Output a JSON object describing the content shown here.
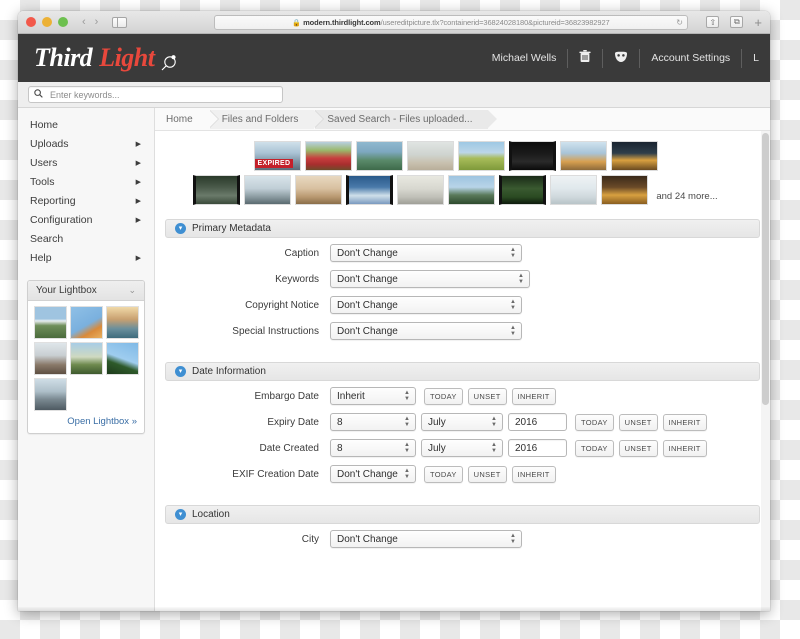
{
  "browser": {
    "url_prefix": "modern.thirdlight.com",
    "url_path": "/usereditpicture.tlx?containerid=36824028180&pictureid=36823982927",
    "lock_icon": "lock-icon",
    "back_icon": "‹",
    "forward_icon": "›",
    "reload_icon": "↻",
    "share_icon": "⇧",
    "tabs_icon": "⧉",
    "new_tab_icon": "+"
  },
  "header": {
    "logo_first": "Third",
    "logo_second": "Light",
    "user_name": "Michael Wells",
    "trash_icon": "🗑",
    "mask_icon": "☺",
    "account_settings": "Account Settings",
    "logout_partial": "L"
  },
  "search": {
    "placeholder": "Enter keywords...",
    "value": "",
    "icon": "search-icon"
  },
  "sidebar": {
    "items": [
      {
        "label": "Home",
        "arrow": ""
      },
      {
        "label": "Uploads",
        "arrow": "▶"
      },
      {
        "label": "Users",
        "arrow": "▶"
      },
      {
        "label": "Tools",
        "arrow": "▶"
      },
      {
        "label": "Reporting",
        "arrow": "▶"
      },
      {
        "label": "Configuration",
        "arrow": "▶"
      },
      {
        "label": "Search",
        "arrow": ""
      },
      {
        "label": "Help",
        "arrow": "▶"
      }
    ],
    "lightbox": {
      "title": "Your Lightbox",
      "chevron": "⌄",
      "thumb_count": 7,
      "open_link": "Open Lightbox »"
    }
  },
  "breadcrumb": [
    "Home",
    "Files and Folders",
    "Saved Search - Files uploaded..."
  ],
  "selection": {
    "row1_count": 8,
    "row2_count": 9,
    "expired_badge": "EXPIRED",
    "more_text": "and 24 more..."
  },
  "sections": [
    {
      "title": "Primary Metadata",
      "icon": "chevron-down-circle-icon",
      "rows": [
        {
          "label": "Caption",
          "value": "Don't Change",
          "type": "select",
          "width": "sel-w190"
        },
        {
          "label": "Keywords",
          "value": "Don't Change",
          "type": "select",
          "width": "sel-w200"
        },
        {
          "label": "Copyright Notice",
          "value": "Don't Change",
          "type": "select",
          "width": "sel-w190"
        },
        {
          "label": "Special Instructions",
          "value": "Don't Change",
          "type": "select",
          "width": "sel-w190"
        }
      ]
    },
    {
      "title": "Date Information",
      "icon": "chevron-down-circle-icon",
      "rows": [
        {
          "label": "Embargo Date",
          "value": "Inherit",
          "type": "date-simple"
        },
        {
          "label": "Expiry Date",
          "day": "8",
          "month": "July",
          "year": "2016",
          "type": "date-full"
        },
        {
          "label": "Date Created",
          "day": "8",
          "month": "July",
          "year": "2016",
          "type": "date-full"
        },
        {
          "label": "EXIF Creation Date",
          "value": "Don't Change",
          "type": "date-simple"
        }
      ]
    },
    {
      "title": "Location",
      "icon": "chevron-down-circle-icon",
      "rows": [
        {
          "label": "City",
          "value": "Don't Change",
          "type": "select",
          "width": "sel-w190"
        }
      ]
    }
  ],
  "date_buttons": [
    "TODAY",
    "UNSET",
    "INHERIT"
  ],
  "colors": {
    "accent_blue": "#3f8fd2",
    "logo_red": "#e8483c",
    "header_dark": "#3a3a3a",
    "expired_red": "#c4202a"
  }
}
